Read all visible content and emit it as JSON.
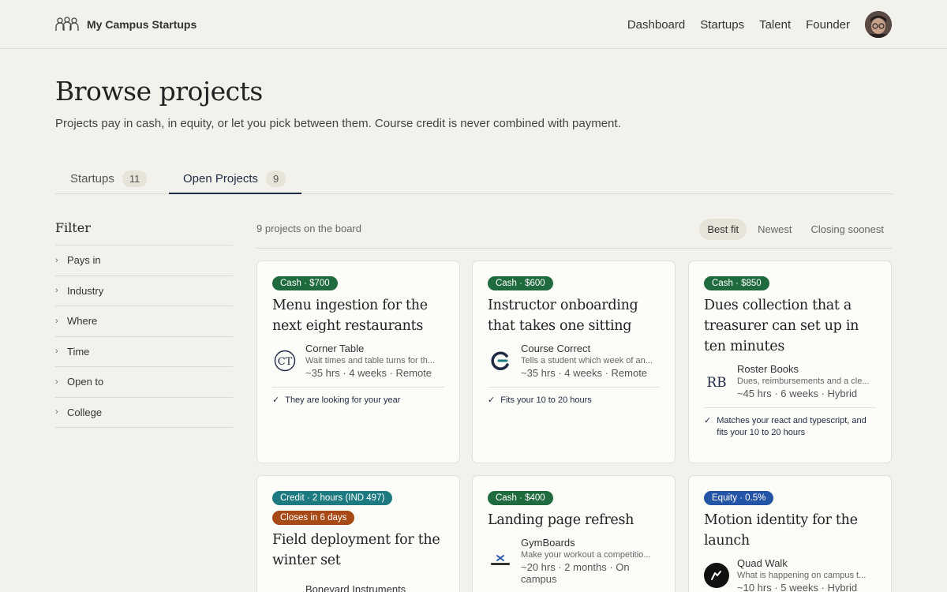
{
  "app": {
    "name": "My Campus Startups"
  },
  "nav": {
    "items": [
      "Dashboard",
      "Startups",
      "Talent",
      "Founder"
    ]
  },
  "header": {
    "title": "Browse projects",
    "subtitle": "Projects pay in cash, in equity, or let you pick between them. Course credit is never combined with payment."
  },
  "tabs": [
    {
      "label": "Startups",
      "count": "11"
    },
    {
      "label": "Open Projects",
      "count": "9",
      "active": true
    }
  ],
  "filter": {
    "title": "Filter",
    "items": [
      "Pays in",
      "Industry",
      "Where",
      "Time",
      "Open to",
      "College"
    ]
  },
  "results": {
    "count_text": "9 projects on the board"
  },
  "sort": {
    "options": [
      "Best fit",
      "Newest",
      "Closing soonest"
    ],
    "selected": "Best fit"
  },
  "cards": [
    {
      "badges": [
        "Cash · $700"
      ],
      "title": "Menu ingestion for the next eight restaurants",
      "company": "Corner Table",
      "description": "Wait times and table turns for th...",
      "meta": "~35 hrs · 4 weeks · Remote",
      "match": "They are looking for your year",
      "logo": "ct-monogram-icon"
    },
    {
      "badges": [
        "Cash · $600"
      ],
      "title": "Instructor onboarding that takes one sitting",
      "company": "Course Correct",
      "description": "Tells a student which week of an...",
      "meta": "~35 hrs · 4 weeks · Remote",
      "match": "Fits your 10 to 20 hours",
      "logo": "cc-swirl-icon"
    },
    {
      "badges": [
        "Cash · $850"
      ],
      "title": "Dues collection that a treasurer can set up in ten minutes",
      "company": "Roster Books",
      "description": "Dues, reimbursements and a cle...",
      "meta": "~45 hrs · 6 weeks · Hybrid",
      "match": "Matches your react and typescript, and fits your 10 to 20 hours",
      "logo": "rb-monogram-icon"
    },
    {
      "badges": [
        "Credit · 2 hours (IND 497)",
        "Closes in 6 days"
      ],
      "title": "Field deployment for the winter set",
      "company": "Boneyard Instruments",
      "description": "",
      "meta": "",
      "match": ""
    },
    {
      "badges": [
        "Cash · $400"
      ],
      "title": "Landing page refresh",
      "company": "GymBoards",
      "description": "Make your workout a competitio...",
      "meta": "~20 hrs · 2 months · On campus",
      "match": "",
      "logo": "gymboards-logo-icon"
    },
    {
      "badges": [
        "Equity · 0.5%"
      ],
      "title": "Motion identity for the launch",
      "company": "Quad Walk",
      "description": "What is happening on campus t...",
      "meta": "~10 hrs · 5 weeks · Hybrid",
      "match": "",
      "logo": "quad-walk-logo-icon"
    }
  ],
  "colors": {
    "cash": "#1f6b3e",
    "credit": "#1d7a80",
    "closes": "#a84a16",
    "equity": "#2454a6",
    "accent": "#1f2a44"
  }
}
